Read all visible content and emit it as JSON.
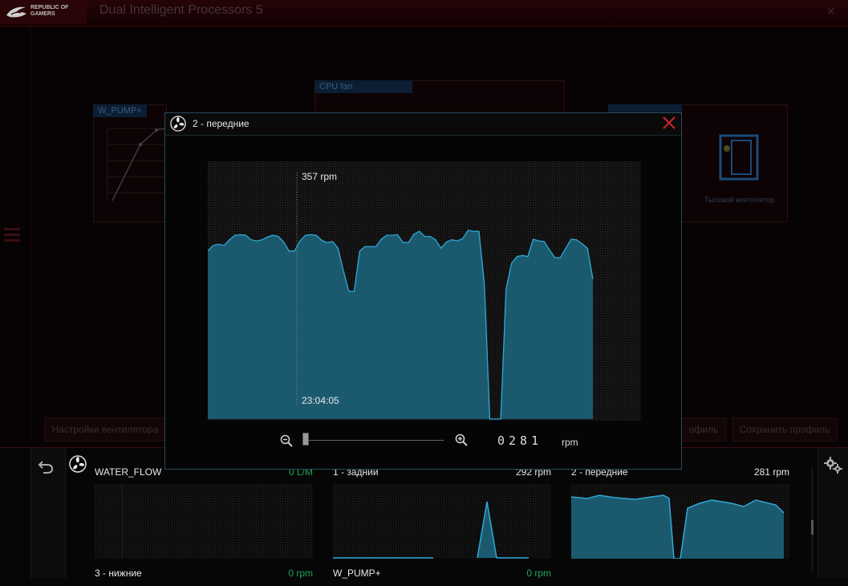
{
  "app": {
    "brand_line1": "REPUBLIC OF",
    "brand_line2": "GAMERS",
    "title": "Dual Intelligent Processors 5"
  },
  "background": {
    "left_tab": "W_PUMP+",
    "center_tab": "CPU fan",
    "right_card_label": "Тыловой вентилятор",
    "btn_fan_settings": "Настройки вентилятора",
    "btn_profile": "офиль",
    "btn_save_profile": "Сохранить профиль"
  },
  "modal": {
    "title": "2 - передние",
    "rpm_readout": "357  rpm",
    "time_readout": "23:04:05",
    "digits": "0281",
    "unit": "rpm"
  },
  "monitors": [
    {
      "label": "WATER_FLOW",
      "value": "0 L/M",
      "value_color": "#1fa45a"
    },
    {
      "label": "1 - задний",
      "value": "292 rpm",
      "value_color": "#e8e8e8"
    },
    {
      "label": "2 - передние",
      "value": "281 rpm",
      "value_color": "#e8e8e8"
    },
    {
      "label": "3 - нижние",
      "value": "0 rpm",
      "value_color": "#1fa45a"
    },
    {
      "label": "W_PUMP+",
      "value": "0 rpm",
      "value_color": "#1fa45a"
    }
  ],
  "colors": {
    "accent_blue": "#2fa9d6",
    "fill_blue": "#1b5a6e",
    "close_red": "#c8242a",
    "ok_green": "#1fa45a"
  },
  "icons": {
    "fan": "fan-icon",
    "close": "close-icon",
    "zoom_in": "zoom-in-icon",
    "zoom_out": "zoom-out-icon",
    "back": "back-arrow-icon",
    "settings": "gear-icon"
  },
  "chart_data": {
    "type": "area",
    "series": [
      {
        "values": [
          300,
          310,
          312,
          310,
          320,
          328,
          329,
          328,
          320,
          318,
          320,
          325,
          328,
          326,
          316,
          300,
          300,
          318,
          328,
          329,
          328,
          319,
          315,
          317,
          305,
          265,
          228,
          228,
          300,
          308,
          308,
          308,
          321,
          328,
          328,
          329,
          315,
          315,
          330,
          335,
          326,
          326,
          320,
          305,
          316,
          320,
          318,
          322,
          337,
          335,
          335,
          240,
          0,
          0,
          0,
          232,
          278,
          290,
          292,
          290,
          321,
          318,
          317,
          302,
          288,
          288,
          305,
          321,
          320,
          313,
          305,
          250
        ]
      }
    ],
    "ylim": [
      0,
      460
    ],
    "grid": true
  }
}
